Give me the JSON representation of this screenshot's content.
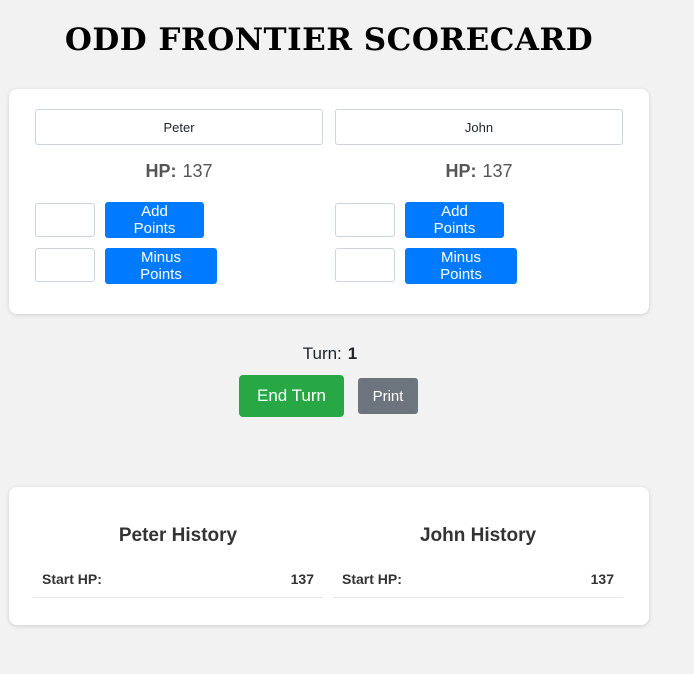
{
  "title": "ODD FRONTIER SCORECARD",
  "players": [
    {
      "name": "Peter",
      "hp_label": "HP:",
      "hp": "137",
      "add_label": "Add Points",
      "minus_label": "Minus Points"
    },
    {
      "name": "John",
      "hp_label": "HP:",
      "hp": "137",
      "add_label": "Add Points",
      "minus_label": "Minus Points"
    }
  ],
  "turn": {
    "label": "Turn:",
    "value": "1"
  },
  "actions": {
    "end_turn": "End Turn",
    "print": "Print"
  },
  "history": [
    {
      "title": "Peter History",
      "rows": [
        {
          "key": "Start HP:",
          "value": "137"
        }
      ]
    },
    {
      "title": "John History",
      "rows": [
        {
          "key": "Start HP:",
          "value": "137"
        }
      ]
    }
  ],
  "colors": {
    "primary": "#007bff",
    "success": "#28a745",
    "secondary": "#6c757d",
    "background": "#f2f2f2"
  }
}
